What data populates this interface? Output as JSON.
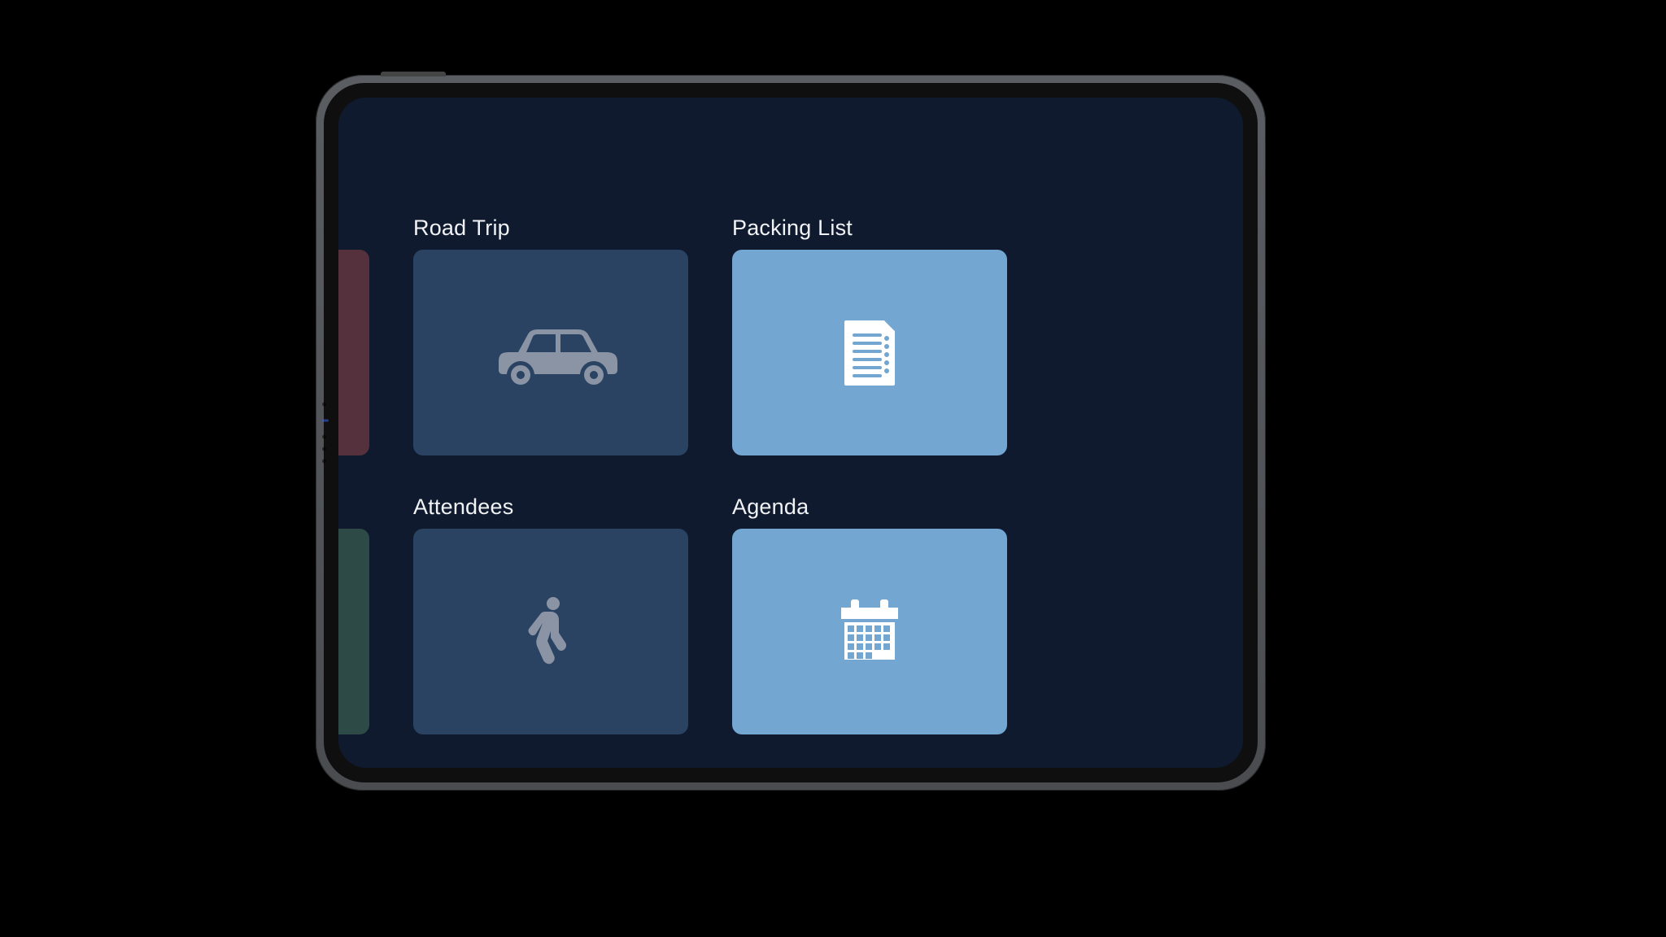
{
  "tiles": {
    "row1": {
      "col1": {
        "title": ""
      },
      "col2": {
        "title": "Road Trip"
      },
      "col3": {
        "title": "Packing List"
      }
    },
    "row2": {
      "col1": {
        "title": ""
      },
      "col2": {
        "title": "Attendees"
      },
      "col3": {
        "title": "Agenda"
      }
    }
  }
}
